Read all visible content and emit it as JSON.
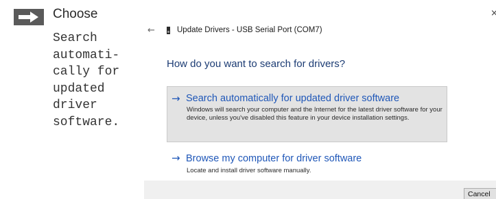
{
  "instruction": {
    "icon": "right-arrow-icon",
    "title": "Choose",
    "body_lines": [
      "Search",
      "automati-",
      "cally for",
      "updated",
      "driver",
      "software."
    ]
  },
  "dialog": {
    "close_glyph": "×",
    "back_icon": "back-arrow-icon",
    "device_icon": "usb-device-icon",
    "title": "Update Drivers - USB Serial Port (COM7)",
    "question": "How do you want to search for drivers?",
    "options": [
      {
        "icon": "right-arrow-icon",
        "label": "Search automatically for updated driver software",
        "description": "Windows will search your computer and the Internet for the latest driver software for your device, unless you've disabled this feature in your device installation settings.",
        "selected": true
      },
      {
        "icon": "right-arrow-icon",
        "label": "Browse my computer for driver software",
        "description": "Locate and install driver software manually.",
        "selected": false
      }
    ],
    "cancel_label": "Cancel"
  },
  "colors": {
    "link_blue": "#1f57b8",
    "question_blue": "#1b3b73",
    "selected_bg": "#e3e3e3",
    "footer_bg": "#f0f0f0",
    "instruction_icon": "#5a5a5a"
  }
}
